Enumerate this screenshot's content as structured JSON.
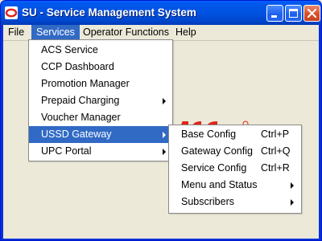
{
  "window": {
    "title": "SU - Service Management System",
    "icon": "oracle-logo-icon",
    "controls": [
      "minimize-icon",
      "maximize-icon",
      "close-icon"
    ]
  },
  "menubar": {
    "items": [
      {
        "label": "File",
        "active": false
      },
      {
        "label": "Services",
        "active": true
      },
      {
        "label": "Operator Functions",
        "active": false
      },
      {
        "label": "Help",
        "active": false
      }
    ]
  },
  "services_menu": {
    "items": [
      {
        "label": "ACS Service"
      },
      {
        "label": "CCP Dashboard"
      },
      {
        "label": "Promotion Manager"
      },
      {
        "label": "Prepaid Charging",
        "submenu": true
      },
      {
        "label": "Voucher Manager"
      },
      {
        "label": "USSD Gateway",
        "submenu": true,
        "highlighted": true
      },
      {
        "label": "UPC Portal",
        "submenu": true
      }
    ]
  },
  "ussd_submenu": {
    "items": [
      {
        "label": "Base Config",
        "shortcut": "Ctrl+P"
      },
      {
        "label": "Gateway Config",
        "shortcut": "Ctrl+Q"
      },
      {
        "label": "Service Config",
        "shortcut": "Ctrl+R"
      },
      {
        "label": "Menu and Status",
        "submenu": true
      },
      {
        "label": "Subscribers",
        "submenu": true
      }
    ]
  },
  "background_logo": {
    "brand_color": "#e2231a"
  },
  "colors": {
    "titlebar": "#0053e3",
    "menu_highlight": "#316ac5",
    "window_background": "#ece9d8"
  }
}
